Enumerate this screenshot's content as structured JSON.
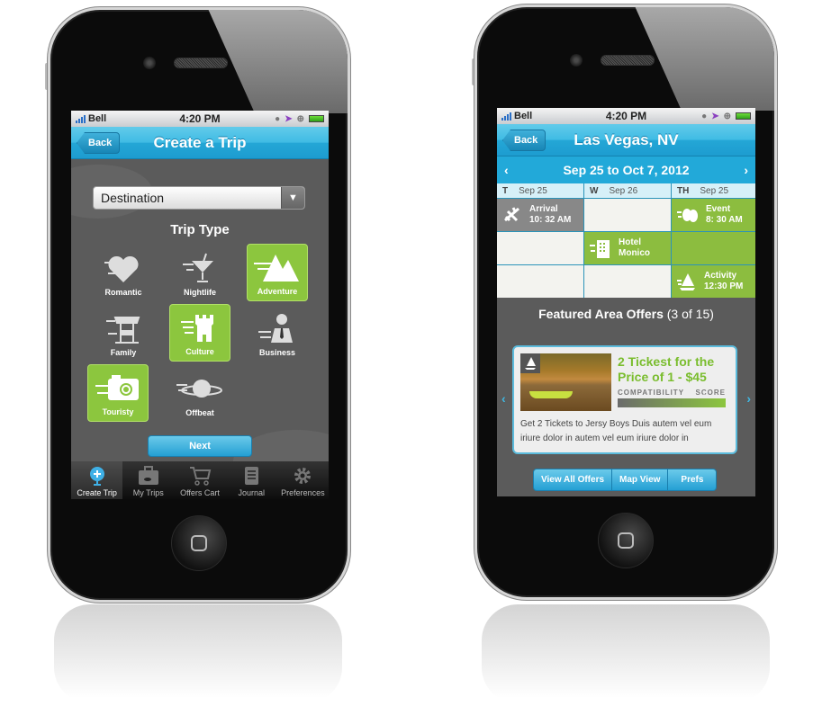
{
  "status_bar": {
    "carrier": "Bell",
    "time": "4:20 PM"
  },
  "left_screen": {
    "nav": {
      "back_label": "Back",
      "title": "Create a Trip"
    },
    "dropdown": {
      "selected": "Destination"
    },
    "trip_type_label": "Trip Type",
    "trip_types": [
      {
        "label": "Romantic",
        "icon": "heart-icon",
        "selected": false
      },
      {
        "label": "Nightlife",
        "icon": "cocktail-icon",
        "selected": false
      },
      {
        "label": "Adventure",
        "icon": "mountains-icon",
        "selected": true
      },
      {
        "label": "Family",
        "icon": "carousel-icon",
        "selected": false
      },
      {
        "label": "Culture",
        "icon": "castle-tower-icon",
        "selected": true
      },
      {
        "label": "Business",
        "icon": "businessman-icon",
        "selected": false
      },
      {
        "label": "Touristy",
        "icon": "camera-icon",
        "selected": true
      },
      {
        "label": "Offbeat",
        "icon": "planet-icon",
        "selected": false
      }
    ],
    "next_label": "Next",
    "tabs": [
      {
        "label": "Create Trip",
        "icon": "globe-icon",
        "active": true
      },
      {
        "label": "My Trips",
        "icon": "suitcase-icon",
        "active": false
      },
      {
        "label": "Offers Cart",
        "icon": "cart-icon",
        "active": false
      },
      {
        "label": "Journal",
        "icon": "notebook-icon",
        "active": false
      },
      {
        "label": "Preferences",
        "icon": "gear-icon",
        "active": false
      }
    ]
  },
  "right_screen": {
    "nav": {
      "back_label": "Back",
      "title": "Las Vegas, NV"
    },
    "date_range": "Sep 25 to Oct 7, 2012",
    "days": [
      {
        "day": "T",
        "date": "Sep 25"
      },
      {
        "day": "W",
        "date": "Sep 26"
      },
      {
        "day": "TH",
        "date": "Sep 25"
      }
    ],
    "events": {
      "arrival": {
        "line1": "Arrival",
        "line2": "10: 32 AM"
      },
      "event": {
        "line1": "Event",
        "line2": "8: 30 AM"
      },
      "hotel": {
        "line1": "Hotel",
        "line2": "Monico"
      },
      "activity": {
        "line1": "Activity",
        "line2": "12:30 PM"
      }
    },
    "featured": {
      "title": "Featured Area Offers",
      "count": "(3 of 15)"
    },
    "offer": {
      "title": "2 Tickest for the Price of 1 - $45",
      "compat_label": "COMPATIBILITY",
      "score_label": "SCORE",
      "score_fraction": 0.8,
      "description": "Get 2 Tickets to Jersy Boys Duis autem vel eum iriure dolor in autem vel eum iriure dolor in"
    },
    "buttons": {
      "view_all": "View All Offers",
      "map_view": "Map View",
      "prefs": "Prefs"
    }
  },
  "colors": {
    "accent_blue": "#22a9d9",
    "accent_green": "#8cc63e",
    "dark_bg": "#5b5b5b"
  }
}
